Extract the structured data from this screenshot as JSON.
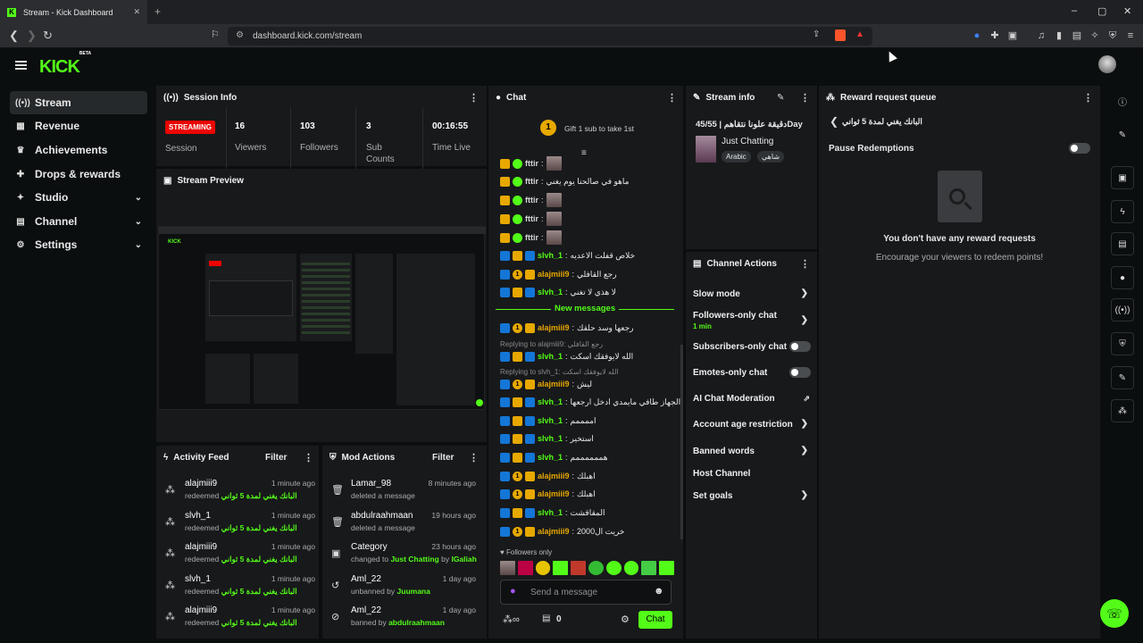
{
  "browser": {
    "tab_title": "Stream - Kick Dashboard",
    "tab_close": "✕",
    "new_tab": "+",
    "url": "dashboard.kick.com/stream",
    "window_controls": [
      "–",
      "▢",
      "✕"
    ]
  },
  "app": {
    "logo": "KICK",
    "logo_tag": "BETA"
  },
  "sidebar": {
    "items": [
      {
        "label": "Stream",
        "icon": "broadcast-icon",
        "glyph": "((•))",
        "active": true
      },
      {
        "label": "Revenue",
        "icon": "revenue-icon",
        "glyph": "▦"
      },
      {
        "label": "Achievements",
        "icon": "trophy-icon",
        "glyph": "♛"
      },
      {
        "label": "Drops & rewards",
        "icon": "gift-icon",
        "glyph": "✚"
      },
      {
        "label": "Studio",
        "icon": "studio-icon",
        "glyph": "✦",
        "expandable": true
      },
      {
        "label": "Channel",
        "icon": "channel-icon",
        "glyph": "▤",
        "expandable": true
      },
      {
        "label": "Settings",
        "icon": "gear-icon",
        "glyph": "⚙",
        "expandable": true
      }
    ]
  },
  "session_info": {
    "title": "Session Info",
    "status_badge": "STREAMING",
    "session_label": "Session",
    "viewers_value": "16",
    "viewers_label": "Viewers",
    "followers_value": "103",
    "followers_label": "Followers",
    "subs_value": "3",
    "subs_label": "Sub Counts",
    "time_value": "00:16:55",
    "time_label": "Time Live"
  },
  "stream_preview": {
    "title": "Stream Preview"
  },
  "activity_feed": {
    "title": "Activity Feed",
    "filter": "Filter",
    "items": [
      {
        "user": "alajmiii9",
        "time": "1 minute ago",
        "action": "redeemed",
        "reward": "البانك يغني لمدة 5 ثواني"
      },
      {
        "user": "slvh_1",
        "time": "1 minute ago",
        "action": "redeemed",
        "reward": "البانك يغني لمدة 5 ثواني"
      },
      {
        "user": "alajmiii9",
        "time": "1 minute ago",
        "action": "redeemed",
        "reward": "البانك يغني لمدة 5 ثواني"
      },
      {
        "user": "slvh_1",
        "time": "1 minute ago",
        "action": "redeemed",
        "reward": "البانك يغني لمدة 5 ثواني"
      },
      {
        "user": "alajmiii9",
        "time": "1 minute ago",
        "action": "redeemed",
        "reward": "البانك يغني لمدة 5 ثواني"
      }
    ]
  },
  "mod_actions": {
    "title": "Mod Actions",
    "filter": "Filter",
    "items": [
      {
        "user": "Lamar_98",
        "time": "8 minutes ago",
        "line": "deleted a message",
        "icon": "trash-icon",
        "glyph": "🗑"
      },
      {
        "user": "abdulraahmaan",
        "time": "19 hours ago",
        "line": "deleted a message",
        "icon": "trash-icon",
        "glyph": "🗑"
      },
      {
        "user": "Category",
        "time": "23 hours ago",
        "line": "changed to ",
        "hl": "Just Chatting",
        "by": " by ",
        "by_user": "IGaliah",
        "icon": "category-icon",
        "glyph": "▣"
      },
      {
        "user": "Aml_22",
        "time": "1 day ago",
        "line": "unbanned by ",
        "hl": "Juumana",
        "icon": "unban-icon",
        "glyph": "↺"
      },
      {
        "user": "Aml_22",
        "time": "1 day ago",
        "line": "banned by ",
        "hl": "abdulraahmaan",
        "icon": "ban-icon",
        "glyph": "⊘"
      }
    ]
  },
  "chat": {
    "title": "Chat",
    "gift_text": "Gift 1 sub to take 1st",
    "gift_rank": "1",
    "new_messages": "New messages",
    "followers_only": "Followers only",
    "input_placeholder": "Send a message",
    "points": "0",
    "send": "Chat",
    "messages": [
      {
        "user": "fttir",
        "color": "gray",
        "badges": [
          "crown",
          "ver"
        ],
        "text": "",
        "emote": true
      },
      {
        "user": "fttir",
        "color": "gray",
        "badges": [
          "crown",
          "ver"
        ],
        "text": "ماهو في صالحنا يوم يغني"
      },
      {
        "user": "fttir",
        "color": "gray",
        "badges": [
          "crown",
          "ver"
        ],
        "text": "",
        "emote": true
      },
      {
        "user": "fttir",
        "color": "gray",
        "badges": [
          "crown",
          "ver"
        ],
        "text": "",
        "emote": true
      },
      {
        "user": "fttir",
        "color": "gray",
        "badges": [
          "crown",
          "ver"
        ],
        "text": "",
        "emote": true
      },
      {
        "user": "slvh_1",
        "color": "green",
        "badges": [
          "vip",
          "crown",
          "vip"
        ],
        "text": "خلاص قفلت الاعديه"
      },
      {
        "user": "alajmiii9",
        "color": "orange",
        "badges": [
          "vip",
          "one",
          "crown"
        ],
        "text": "رجع القافلي"
      },
      {
        "user": "slvh_1",
        "color": "green",
        "badges": [
          "vip",
          "crown",
          "vip"
        ],
        "text": "لا هذي لا تغني"
      },
      {
        "user": "alajmiii9",
        "color": "orange",
        "badges": [
          "vip",
          "one",
          "crown"
        ],
        "text": "رجعها وسد حلقك"
      },
      {
        "user": "slvh_1",
        "color": "green",
        "badges": [
          "vip",
          "crown",
          "vip"
        ],
        "text": "الله لايوفقك اسكت"
      },
      {
        "user": "alajmiii9",
        "color": "orange",
        "badges": [
          "vip",
          "one",
          "crown"
        ],
        "text": "ليش"
      },
      {
        "user": "slvh_1",
        "color": "green",
        "badges": [
          "vip",
          "crown",
          "vip"
        ],
        "text": "الجهاز طافي مايمدي ادخل ارجعها"
      },
      {
        "user": "slvh_1",
        "color": "green",
        "badges": [
          "vip",
          "crown",
          "vip"
        ],
        "text": "اممممم"
      },
      {
        "user": "slvh_1",
        "color": "green",
        "badges": [
          "vip",
          "crown",
          "vip"
        ],
        "text": "استخير"
      },
      {
        "user": "slvh_1",
        "color": "green",
        "badges": [
          "vip",
          "crown",
          "vip"
        ],
        "text": "هممممممم"
      },
      {
        "user": "alajmiii9",
        "color": "orange",
        "badges": [
          "vip",
          "one",
          "crown"
        ],
        "text": "اهبلك"
      },
      {
        "user": "alajmiii9",
        "color": "orange",
        "badges": [
          "vip",
          "one",
          "crown"
        ],
        "text": "اهبلك"
      },
      {
        "user": "slvh_1",
        "color": "green",
        "badges": [
          "vip",
          "crown",
          "vip"
        ],
        "text": "المقاقشت"
      },
      {
        "user": "alajmiii9",
        "color": "orange",
        "badges": [
          "vip",
          "one",
          "crown"
        ],
        "text": "خريت ال2000"
      }
    ],
    "reply1": "Replying to alajmiii9: رجع القافلي",
    "reply2": "Replying to slvh_1: الله لايوفقك اسكت"
  },
  "stream_info": {
    "title": "Stream info",
    "stream_title": "دقيقة علونا نتقاهم | 45/55Day",
    "category": "Just Chatting",
    "tags": [
      "Arabic",
      "شاهي"
    ]
  },
  "channel_actions": {
    "title": "Channel Actions",
    "rows": [
      {
        "label": "Slow mode",
        "type": "chevron"
      },
      {
        "label": "Followers-only chat",
        "sub": "1 min",
        "type": "chevron"
      },
      {
        "label": "Subscribers-only chat",
        "type": "toggle"
      },
      {
        "label": "Emotes-only chat",
        "type": "toggle"
      },
      {
        "label": "AI Chat Moderation",
        "type": "external"
      },
      {
        "label": "Account age restriction",
        "type": "chevron"
      },
      {
        "label": "Banned words",
        "type": "chevron"
      },
      {
        "label": "Host Channel",
        "type": "none"
      },
      {
        "label": "Set goals",
        "type": "chevron"
      }
    ]
  },
  "reward_queue": {
    "title": "Reward request queue",
    "reward_name": "البانك يغني لمدة 5 ثواني",
    "pause_label": "Pause Redemptions",
    "empty_title": "You don't have any reward requests",
    "empty_sub": "Encourage your viewers to redeem points!"
  },
  "colors": {
    "accent": "#53fc18",
    "live": "#eb0400",
    "panel": "#18191b"
  }
}
